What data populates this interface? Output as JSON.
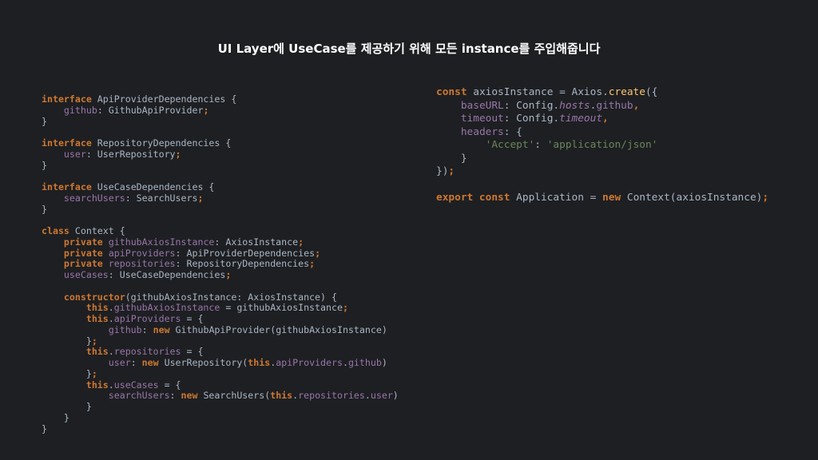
{
  "title": "UI Layer에 UseCase를 제공하기 위해 모든 instance를 주입해줍니다",
  "colors": {
    "background": "#1e1f22",
    "text": "#a9b7c6",
    "keyword": "#cc7832",
    "property": "#9876aa",
    "function": "#ffc66d",
    "string": "#6a8759",
    "title": "#ffffff"
  },
  "left_code": [
    [
      {
        "t": "kw",
        "v": "interface"
      },
      {
        "t": "plain",
        "v": " ApiProviderDependencies {"
      }
    ],
    [
      {
        "t": "plain",
        "v": "    "
      },
      {
        "t": "prop",
        "v": "github"
      },
      {
        "t": "plain",
        "v": ": GithubApiProvider"
      },
      {
        "t": "kw",
        "v": ";"
      }
    ],
    [
      {
        "t": "plain",
        "v": "}"
      }
    ],
    [
      {
        "t": "plain",
        "v": ""
      }
    ],
    [
      {
        "t": "kw",
        "v": "interface"
      },
      {
        "t": "plain",
        "v": " RepositoryDependencies {"
      }
    ],
    [
      {
        "t": "plain",
        "v": "    "
      },
      {
        "t": "prop",
        "v": "user"
      },
      {
        "t": "plain",
        "v": ": UserRepository"
      },
      {
        "t": "kw",
        "v": ";"
      }
    ],
    [
      {
        "t": "plain",
        "v": "}"
      }
    ],
    [
      {
        "t": "plain",
        "v": ""
      }
    ],
    [
      {
        "t": "kw",
        "v": "interface"
      },
      {
        "t": "plain",
        "v": " UseCaseDependencies {"
      }
    ],
    [
      {
        "t": "plain",
        "v": "    "
      },
      {
        "t": "prop",
        "v": "searchUsers"
      },
      {
        "t": "plain",
        "v": ": SearchUsers"
      },
      {
        "t": "kw",
        "v": ";"
      }
    ],
    [
      {
        "t": "plain",
        "v": "}"
      }
    ],
    [
      {
        "t": "plain",
        "v": ""
      }
    ],
    [
      {
        "t": "kw",
        "v": "class"
      },
      {
        "t": "plain",
        "v": " Context {"
      }
    ],
    [
      {
        "t": "plain",
        "v": "    "
      },
      {
        "t": "kw",
        "v": "private"
      },
      {
        "t": "plain",
        "v": " "
      },
      {
        "t": "prop",
        "v": "githubAxiosInstance"
      },
      {
        "t": "plain",
        "v": ": AxiosInstance"
      },
      {
        "t": "kw",
        "v": ";"
      }
    ],
    [
      {
        "t": "plain",
        "v": "    "
      },
      {
        "t": "kw",
        "v": "private"
      },
      {
        "t": "plain",
        "v": " "
      },
      {
        "t": "prop",
        "v": "apiProviders"
      },
      {
        "t": "plain",
        "v": ": ApiProviderDependencies"
      },
      {
        "t": "kw",
        "v": ";"
      }
    ],
    [
      {
        "t": "plain",
        "v": "    "
      },
      {
        "t": "kw",
        "v": "private"
      },
      {
        "t": "plain",
        "v": " "
      },
      {
        "t": "prop",
        "v": "repositories"
      },
      {
        "t": "plain",
        "v": ": RepositoryDependencies"
      },
      {
        "t": "kw",
        "v": ";"
      }
    ],
    [
      {
        "t": "plain",
        "v": "    "
      },
      {
        "t": "prop",
        "v": "useCases"
      },
      {
        "t": "plain",
        "v": ": UseCaseDependencies"
      },
      {
        "t": "kw",
        "v": ";"
      }
    ],
    [
      {
        "t": "plain",
        "v": ""
      }
    ],
    [
      {
        "t": "plain",
        "v": "    "
      },
      {
        "t": "kw",
        "v": "constructor"
      },
      {
        "t": "plain",
        "v": "(githubAxiosInstance: AxiosInstance) {"
      }
    ],
    [
      {
        "t": "plain",
        "v": "        "
      },
      {
        "t": "kw",
        "v": "this"
      },
      {
        "t": "plain",
        "v": "."
      },
      {
        "t": "prop",
        "v": "githubAxiosInstance"
      },
      {
        "t": "plain",
        "v": " = githubAxiosInstance"
      },
      {
        "t": "kw",
        "v": ";"
      }
    ],
    [
      {
        "t": "plain",
        "v": "        "
      },
      {
        "t": "kw",
        "v": "this"
      },
      {
        "t": "plain",
        "v": "."
      },
      {
        "t": "prop",
        "v": "apiProviders"
      },
      {
        "t": "plain",
        "v": " = {"
      }
    ],
    [
      {
        "t": "plain",
        "v": "            "
      },
      {
        "t": "prop",
        "v": "github"
      },
      {
        "t": "plain",
        "v": ": "
      },
      {
        "t": "kw",
        "v": "new"
      },
      {
        "t": "plain",
        "v": " GithubApiProvider(githubAxiosInstance)"
      }
    ],
    [
      {
        "t": "plain",
        "v": "        }"
      },
      {
        "t": "kw",
        "v": ";"
      }
    ],
    [
      {
        "t": "plain",
        "v": "        "
      },
      {
        "t": "kw",
        "v": "this"
      },
      {
        "t": "plain",
        "v": "."
      },
      {
        "t": "prop",
        "v": "repositories"
      },
      {
        "t": "plain",
        "v": " = {"
      }
    ],
    [
      {
        "t": "plain",
        "v": "            "
      },
      {
        "t": "prop",
        "v": "user"
      },
      {
        "t": "plain",
        "v": ": "
      },
      {
        "t": "kw",
        "v": "new"
      },
      {
        "t": "plain",
        "v": " UserRepository("
      },
      {
        "t": "kw",
        "v": "this"
      },
      {
        "t": "plain",
        "v": "."
      },
      {
        "t": "prop",
        "v": "apiProviders"
      },
      {
        "t": "plain",
        "v": "."
      },
      {
        "t": "prop",
        "v": "github"
      },
      {
        "t": "plain",
        "v": ")"
      }
    ],
    [
      {
        "t": "plain",
        "v": "        }"
      },
      {
        "t": "kw",
        "v": ";"
      }
    ],
    [
      {
        "t": "plain",
        "v": "        "
      },
      {
        "t": "kw",
        "v": "this"
      },
      {
        "t": "plain",
        "v": "."
      },
      {
        "t": "prop",
        "v": "useCases"
      },
      {
        "t": "plain",
        "v": " = {"
      }
    ],
    [
      {
        "t": "plain",
        "v": "            "
      },
      {
        "t": "prop",
        "v": "searchUsers"
      },
      {
        "t": "plain",
        "v": ": "
      },
      {
        "t": "kw",
        "v": "new"
      },
      {
        "t": "plain",
        "v": " SearchUsers("
      },
      {
        "t": "kw",
        "v": "this"
      },
      {
        "t": "plain",
        "v": "."
      },
      {
        "t": "prop",
        "v": "repositories"
      },
      {
        "t": "plain",
        "v": "."
      },
      {
        "t": "prop",
        "v": "user"
      },
      {
        "t": "plain",
        "v": ")"
      }
    ],
    [
      {
        "t": "plain",
        "v": "        }"
      }
    ],
    [
      {
        "t": "plain",
        "v": "    }"
      }
    ],
    [
      {
        "t": "plain",
        "v": "}"
      }
    ]
  ],
  "right_code": [
    [
      {
        "t": "kw",
        "v": "const"
      },
      {
        "t": "plain",
        "v": " axiosInstance = Axios."
      },
      {
        "t": "fn",
        "v": "create"
      },
      {
        "t": "plain",
        "v": "({"
      }
    ],
    [
      {
        "t": "plain",
        "v": "    "
      },
      {
        "t": "prop",
        "v": "baseURL"
      },
      {
        "t": "plain",
        "v": ": Config."
      },
      {
        "t": "it",
        "v": "hosts"
      },
      {
        "t": "plain",
        "v": "."
      },
      {
        "t": "prop",
        "v": "github"
      },
      {
        "t": "kw",
        "v": ","
      }
    ],
    [
      {
        "t": "plain",
        "v": "    "
      },
      {
        "t": "prop",
        "v": "timeout"
      },
      {
        "t": "plain",
        "v": ": Config."
      },
      {
        "t": "it",
        "v": "timeout"
      },
      {
        "t": "kw",
        "v": ","
      }
    ],
    [
      {
        "t": "plain",
        "v": "    "
      },
      {
        "t": "prop",
        "v": "headers"
      },
      {
        "t": "plain",
        "v": ": {"
      }
    ],
    [
      {
        "t": "plain",
        "v": "        "
      },
      {
        "t": "str",
        "v": "'Accept'"
      },
      {
        "t": "plain",
        "v": ": "
      },
      {
        "t": "str",
        "v": "'application/json'"
      }
    ],
    [
      {
        "t": "plain",
        "v": "    }"
      }
    ],
    [
      {
        "t": "plain",
        "v": "})"
      },
      {
        "t": "kw",
        "v": ";"
      }
    ],
    [
      {
        "t": "plain",
        "v": ""
      }
    ],
    [
      {
        "t": "kw",
        "v": "export const"
      },
      {
        "t": "plain",
        "v": " Application = "
      },
      {
        "t": "kw",
        "v": "new"
      },
      {
        "t": "plain",
        "v": " Context(axiosInstance)"
      },
      {
        "t": "kw",
        "v": ";"
      }
    ]
  ]
}
